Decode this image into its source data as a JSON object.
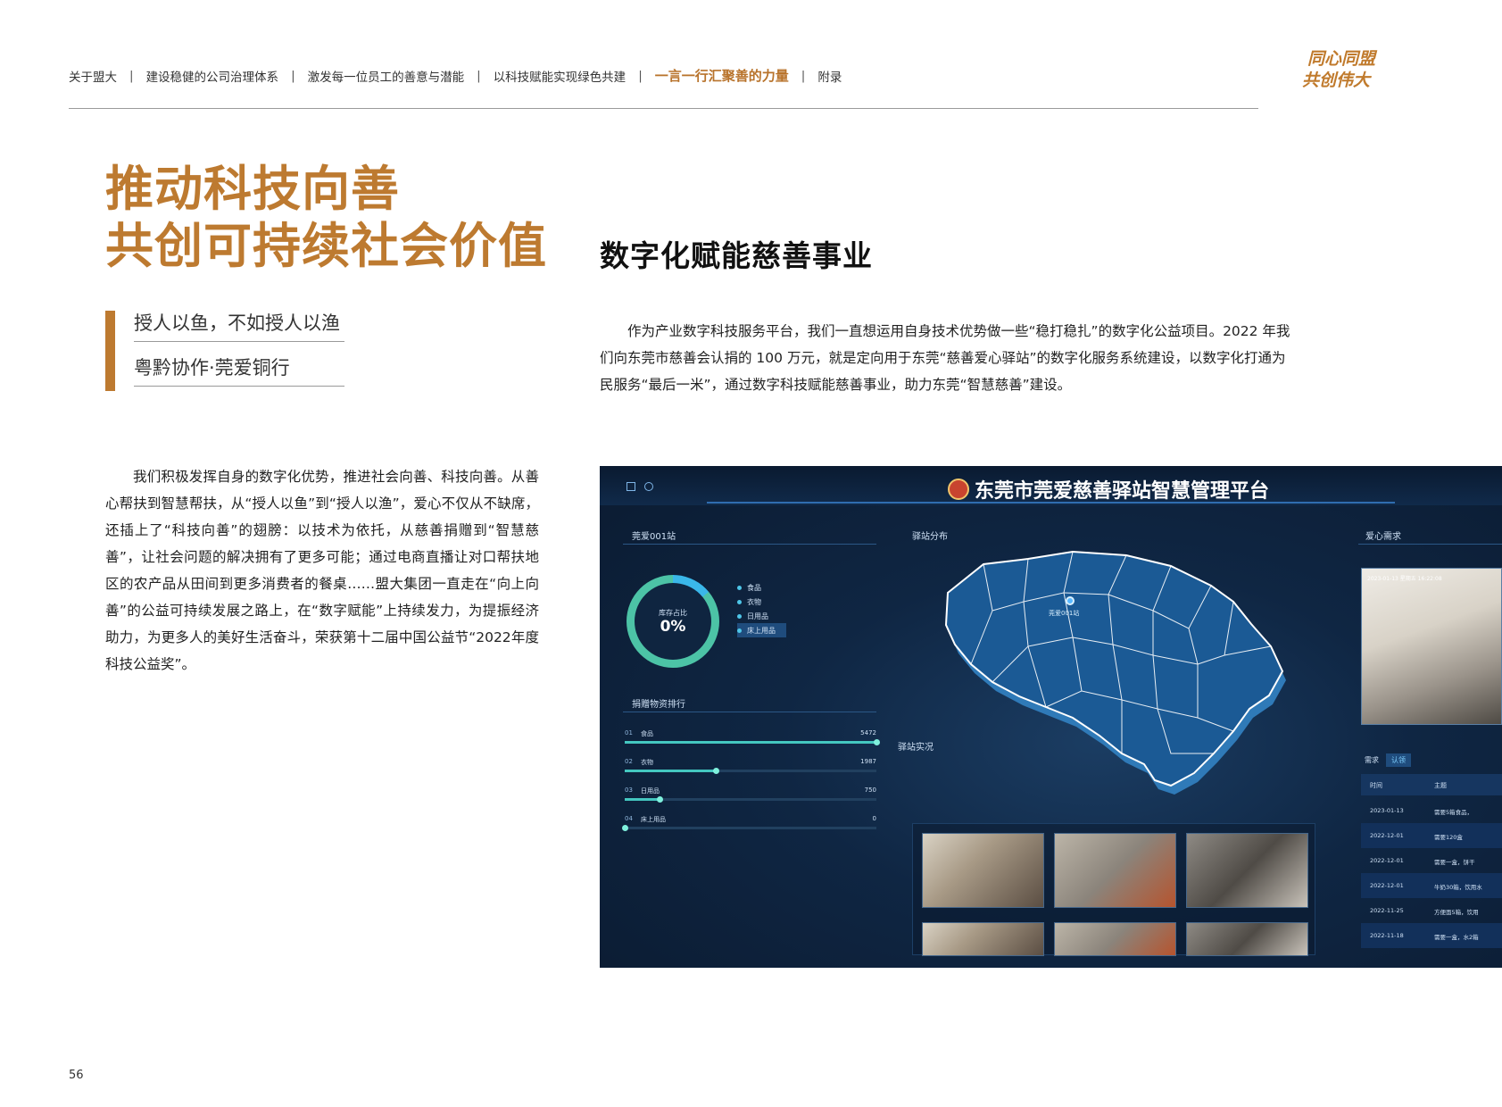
{
  "nav": {
    "items": [
      "关于盟大",
      "建设稳健的公司治理体系",
      "激发每一位员工的善意与潜能",
      "以科技赋能实现绿色共建",
      "一言一行汇聚善的力量",
      "附录"
    ],
    "separator": "|",
    "active_index": 4
  },
  "slogan": {
    "line1": "同心同盟",
    "line2": "共创伟大"
  },
  "main_title": {
    "line1": "推动科技向善",
    "line2": "共创可持续社会价值"
  },
  "subtitles": [
    "授人以鱼，不如授人以渔",
    "粤黔协作·莞爱铜行"
  ],
  "left_body": "我们积极发挥自身的数字化优势，推进社会向善、科技向善。从善心帮扶到智慧帮扶，从“授人以鱼”到“授人以渔”，爱心不仅从不缺席，还插上了“科技向善”的翅膀：以技术为依托，从慈善捐赠到“智慧慈善”，让社会问题的解决拥有了更多可能；通过电商直播让对口帮扶地区的农产品从田间到更多消费者的餐桌……盟大集团一直走在“向上向善”的公益可持续发展之路上，在“数字赋能”上持续发力，为提振经济助力，为更多人的美好生活奋斗，荣获第十二届中国公益节“2022年度科技公益奖”。",
  "section_title": "数字化赋能慈善事业",
  "right_body": "作为产业数字科技服务平台，我们一直想运用自身技术优势做一些“稳打稳扎”的数字化公益项目。2022 年我们向东莞市慈善会认捐的 100 万元，就是定向用于东莞“慈善爱心驿站”的数字化服务系统建设，以数字化打通为民服务“最后一米”，通过数字科技赋能慈善事业，助力东莞“智慧慈善”建设。",
  "dashboard": {
    "title": "东莞市莞爱慈善驿站智慧管理平台",
    "panels": {
      "station": "莞爱001站",
      "distribution": "驿站分布",
      "love": "爱心需求",
      "ranking": "捐赠物资排行",
      "live": "驿站实况"
    },
    "ring": {
      "caption": "库存占比",
      "value": "0%",
      "fraction": 0.14
    },
    "legend": [
      "食品",
      "衣物",
      "日用品",
      "床上用品"
    ],
    "legend_selected": 3,
    "ranking": [
      {
        "no": "01",
        "name": "食品",
        "value": "5472",
        "fraction": 1.0
      },
      {
        "no": "02",
        "name": "衣物",
        "value": "1987",
        "fraction": 0.36
      },
      {
        "no": "03",
        "name": "日用品",
        "value": "750",
        "fraction": 0.14
      },
      {
        "no": "04",
        "name": "床上用品",
        "value": "0",
        "fraction": 0.0
      }
    ],
    "map_pin_label": "莞爱001站",
    "photo_timestamp": "2023-01-13 星期五 16:22:08",
    "tabs": [
      "需求",
      "认领"
    ],
    "table_headers": [
      "时间",
      "主题"
    ],
    "table_rows": [
      {
        "date": "2023-01-13",
        "subject": "需要5箱食品，"
      },
      {
        "date": "2022-12-01",
        "subject": "需要120盒"
      },
      {
        "date": "2022-12-01",
        "subject": "需要一盒，饼干"
      },
      {
        "date": "2022-12-01",
        "subject": "牛奶30箱，饮用水"
      },
      {
        "date": "2022-11-25",
        "subject": "方便面5箱，饮用"
      },
      {
        "date": "2022-11-18",
        "subject": "需要一盒，水2箱"
      }
    ]
  },
  "page_number": "56"
}
